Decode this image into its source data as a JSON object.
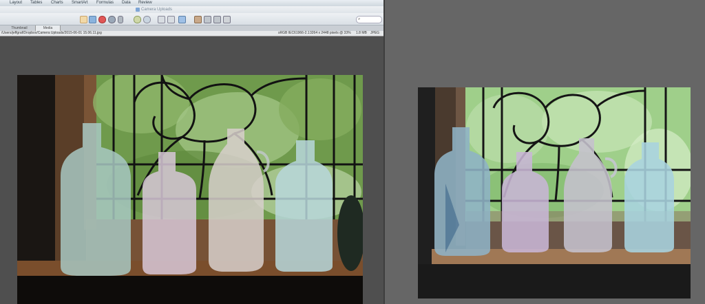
{
  "menu": {
    "items": [
      "Layout",
      "Tables",
      "Charts",
      "SmartArt",
      "Formulas",
      "Data",
      "Review"
    ]
  },
  "document": {
    "title": "Camera Uploads"
  },
  "search": {
    "placeholder": ""
  },
  "tabs": [
    {
      "label": "Thumbnail",
      "active": false
    },
    {
      "label": "Media",
      "active": true
    }
  ],
  "pathbar": {
    "path": "/Users/jeffgraf/Dropbox/Camera Uploads/2015-06-01 15.06.11.jpg",
    "colorspace": "sRGB IEC61966-2.1",
    "dimensions": "3264 x 2448 pixels @ 33%",
    "filesize": "1.8 MB",
    "format": "JPEG"
  },
  "colors": {
    "toolbar_bg": "#dfe4e9",
    "workspace_left": "#4f4f4f",
    "workspace_right": "#666666",
    "leaded_glass": "#121212",
    "window_sill": "#7a4e2c",
    "foliage": "#6f9a4c"
  },
  "icons": [
    "search-icon",
    "brush-icon",
    "adjust-icon",
    "rotate-icon",
    "zoom-icon",
    "crop-icon",
    "save-icon",
    "print-icon"
  ]
}
